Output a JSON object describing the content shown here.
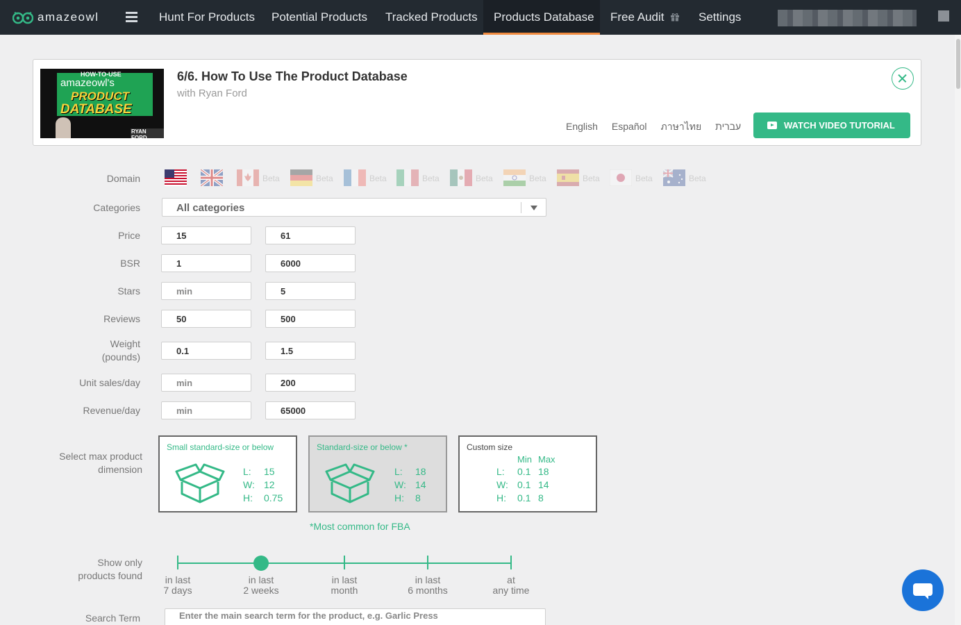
{
  "nav": {
    "logo_text": "amazeowl",
    "items": [
      {
        "label": "Hunt For Products"
      },
      {
        "label": "Potential Products"
      },
      {
        "label": "Tracked Products"
      },
      {
        "label": "Products Database",
        "active": true
      },
      {
        "label": "Free Audit"
      },
      {
        "label": "Settings"
      }
    ]
  },
  "tutorial": {
    "thumb": {
      "line1": "HOW-TO-USE",
      "line2": "amazeowl's",
      "line3": "PRODUCT",
      "line4": "DATABASE",
      "line5": "RYAN FORD"
    },
    "title": "6/6. How To Use The Product Database",
    "subtitle": "with Ryan Ford",
    "languages": [
      "English",
      "Español",
      "ภาษาไทย",
      "עברית"
    ],
    "watch_label": "WATCH VIDEO TUTORIAL"
  },
  "form": {
    "domain_label": "Domain",
    "domains": [
      {
        "icon": "us-flag-icon",
        "beta": ""
      },
      {
        "icon": "uk-flag-icon",
        "beta": ""
      },
      {
        "icon": "canada-flag-icon",
        "beta": "Beta"
      },
      {
        "icon": "germany-flag-icon",
        "beta": "Beta"
      },
      {
        "icon": "france-flag-icon",
        "beta": "Beta"
      },
      {
        "icon": "italy-flag-icon",
        "beta": "Beta"
      },
      {
        "icon": "mexico-flag-icon",
        "beta": "Beta"
      },
      {
        "icon": "india-flag-icon",
        "beta": "Beta"
      },
      {
        "icon": "spain-flag-icon",
        "beta": "Beta"
      },
      {
        "icon": "japan-flag-icon",
        "beta": "Beta"
      },
      {
        "icon": "australia-flag-icon",
        "beta": "Beta"
      }
    ],
    "categories_label": "Categories",
    "categories_value": "All categories",
    "price_label": "Price",
    "price_min": "15",
    "price_max": "61",
    "bsr_label": "BSR",
    "bsr_min": "1",
    "bsr_max": "6000",
    "stars_label": "Stars",
    "stars_min": "",
    "stars_max": "5",
    "reviews_label": "Reviews",
    "reviews_min": "50",
    "reviews_max": "500",
    "weight_label_1": "Weight",
    "weight_label_2": "(pounds)",
    "weight_min": "0.1",
    "weight_max": "1.5",
    "unit_sales_label": "Unit sales/day",
    "unit_sales_min": "",
    "unit_sales_max": "200",
    "revenue_label": "Revenue/day",
    "revenue_min": "",
    "revenue_max": "65000",
    "min_placeholder": "min",
    "dimension_label_1": "Select max product",
    "dimension_label_2": "dimension",
    "dimension_boxes": [
      {
        "title": "Small standard-size or below",
        "L": "15",
        "W": "12",
        "H": "0.75"
      },
      {
        "title": "Standard-size or below *",
        "L": "18",
        "W": "14",
        "H": "8",
        "selected": true
      },
      {
        "title": "Custom size",
        "min_head": "Min",
        "max_head": "Max",
        "L_min": "0.1",
        "L_max": "18",
        "W_min": "0.1",
        "W_max": "14",
        "H_min": "0.1",
        "H_max": "8"
      }
    ],
    "dim_keys": {
      "L": "L:",
      "W": "W:",
      "H": "H:"
    },
    "fba_note": "*Most common for FBA",
    "show_only_label_1": "Show only",
    "show_only_label_2": "products found",
    "time_stops": [
      {
        "line1": "in last",
        "line2": "7 days"
      },
      {
        "line1": "in last",
        "line2": "2 weeks"
      },
      {
        "line1": "in last",
        "line2": "month"
      },
      {
        "line1": "in last",
        "line2": "6 months"
      },
      {
        "line1": "at",
        "line2": "any time"
      }
    ],
    "time_selected_index": 1,
    "search_label": "Search Term",
    "search_placeholder": "Enter the main search term for the product, e.g. Garlic Press"
  },
  "colors": {
    "accent": "#34b987",
    "nav_bg": "#232a31",
    "active_underline": "#f08a3e",
    "chat": "#1a73d9"
  }
}
